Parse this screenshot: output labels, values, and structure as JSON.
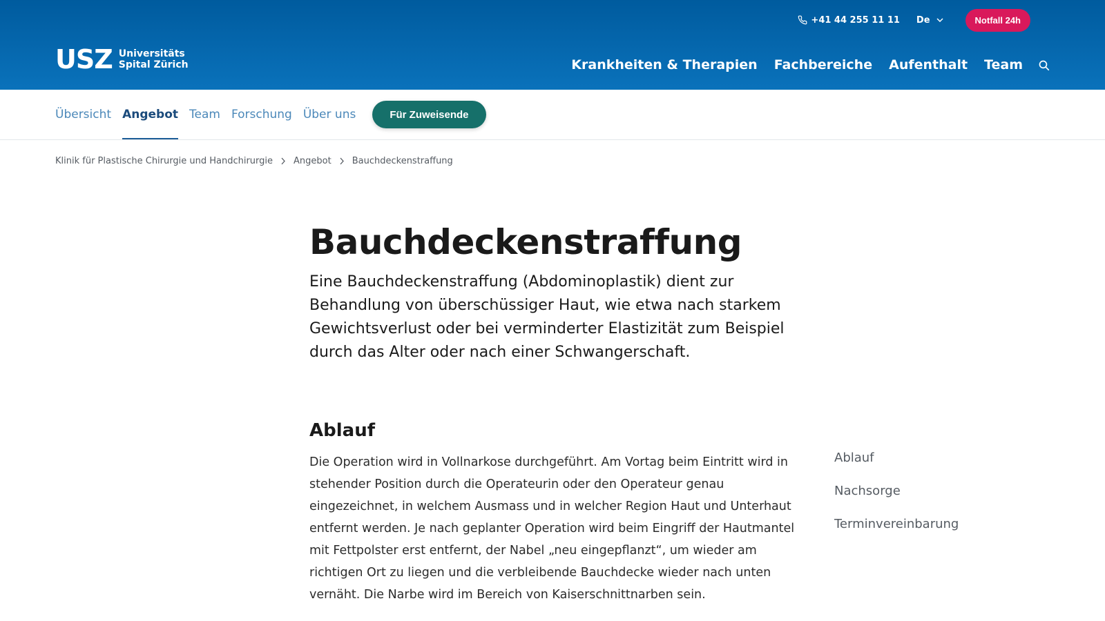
{
  "header": {
    "phone": "+41 44 255 11 11",
    "language": "De",
    "emergency_label": "Notfall 24h",
    "logo_mark": "USZ",
    "logo_line1": "Universitäts",
    "logo_line2": "Spital Zürich",
    "nav": [
      "Krankheiten & Therapien",
      "Fachbereiche",
      "Aufenthalt",
      "Team"
    ],
    "icons": [
      "phone-icon",
      "chevron-down-icon",
      "search-icon"
    ]
  },
  "subnav": {
    "items": [
      "Übersicht",
      "Angebot",
      "Team",
      "Forschung",
      "Über uns"
    ],
    "active": "Angebot",
    "cta_label": "Für Zuweisende"
  },
  "breadcrumb": [
    "Klinik für Plastische Chirurgie und Handchirurgie",
    "Angebot",
    "Bauchdeckenstraffung"
  ],
  "main": {
    "title": "Bauchdeckenstraffung",
    "lead": "Eine Bauchdeckenstraffung (Abdominoplastik) dient zur Behandlung von überschüssiger Haut, wie etwa nach starkem Gewichtsverlust oder bei verminderter Elastizität zum Beispiel durch das Alter oder nach einer Schwangerschaft.",
    "section_title": "Ablauf",
    "section_text": "Die Operation wird in Vollnarkose durchgeführt. Am Vortag beim Eintritt wird in stehender Position durch die Operateurin oder den Operateur genau eingezeichnet, in welchem Ausmass und in welcher Region Haut und Unterhaut entfernt werden. Je nach geplanter Operation wird beim Eingriff der Hautmantel mit Fettpolster erst entfernt, der Nabel „neu eingepflanzt“, um wieder am richtigen Ort zu liegen und die verbleibende Bauchdecke wieder nach unten vernäht. Die Narbe wird im Bereich von Kaiserschnittnarben sein."
  },
  "toc": [
    "Ablauf",
    "Nachsorge",
    "Terminvereinbarung"
  ],
  "colors": {
    "header_top": "#005b9e",
    "header_bottom": "#0a72bb",
    "emergency": "#d9195b",
    "cta": "#16706a",
    "subnav_link": "#4b88b9",
    "subnav_active": "#1b4b7c"
  }
}
